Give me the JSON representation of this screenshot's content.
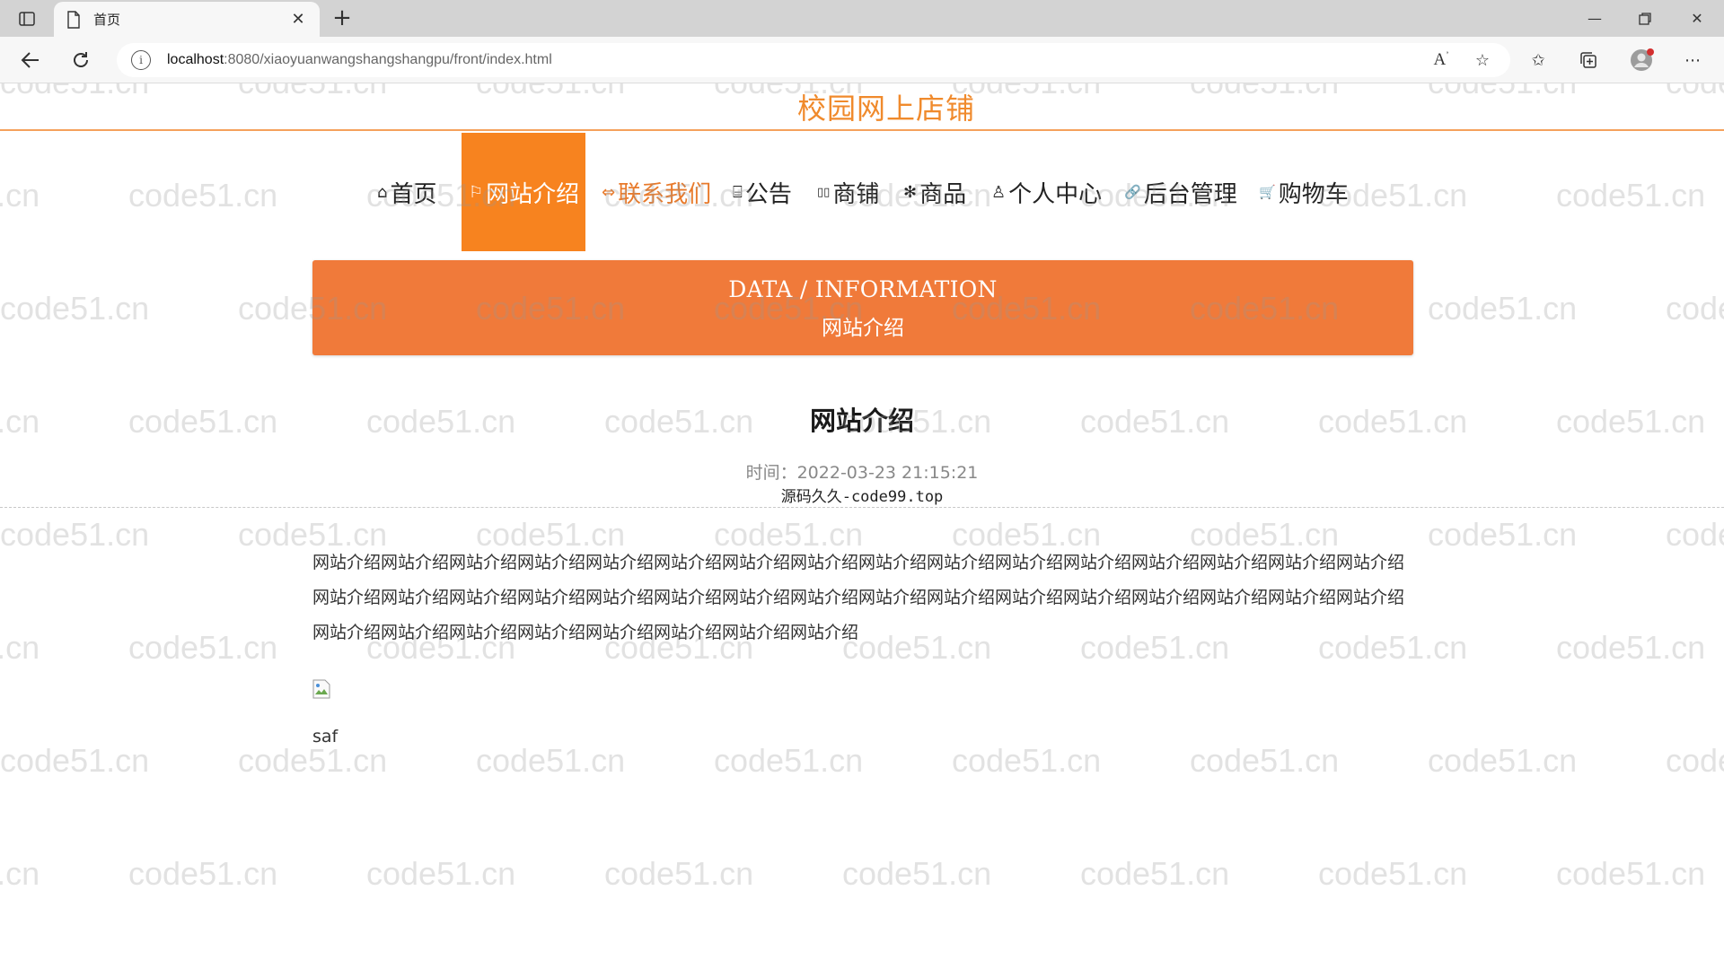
{
  "browser": {
    "tab_title": "首页",
    "url_host": "localhost",
    "url_path": ":8080/xiaoyuanwangshangshangpu/front/index.html"
  },
  "site": {
    "title": "校园网上店铺"
  },
  "nav": {
    "items": [
      {
        "label": "首页",
        "icon": "home-icon",
        "glyph": "⌂"
      },
      {
        "label": "网站介绍",
        "icon": "flag-icon",
        "glyph": "⚐"
      },
      {
        "label": "联系我们",
        "icon": "contact-icon",
        "glyph": "⇔"
      },
      {
        "label": "公告",
        "icon": "book-icon",
        "glyph": "⌸"
      },
      {
        "label": "商铺",
        "icon": "shop-icon",
        "glyph": "▯▯"
      },
      {
        "label": "商品",
        "icon": "asterisk-icon",
        "glyph": "✻"
      },
      {
        "label": "个人中心",
        "icon": "user-icon",
        "glyph": "♙"
      },
      {
        "label": "后台管理",
        "icon": "link-icon",
        "glyph": "🔗"
      },
      {
        "label": "购物车",
        "icon": "cart-icon",
        "glyph": "🛒"
      }
    ]
  },
  "banner": {
    "english": "DATA / INFORMATION",
    "chinese": "网站介绍"
  },
  "article": {
    "title": "网站介绍",
    "time": "时间：2022-03-23 21:15:21",
    "source": "源码久久-code99.top",
    "body": "网站介绍网站介绍网站介绍网站介绍网站介绍网站介绍网站介绍网站介绍网站介绍网站介绍网站介绍网站介绍网站介绍网站介绍网站介绍网站介绍网站介绍网站介绍网站介绍网站介绍网站介绍网站介绍网站介绍网站介绍网站介绍网站介绍网站介绍网站介绍网站介绍网站介绍网站介绍网站介绍网站介绍网站介绍网站介绍网站介绍网站介绍网站介绍网站介绍网站介绍",
    "caption": "saf"
  },
  "watermark": "code51.cn",
  "colors": {
    "accent": "#f7831f",
    "banner": "#f07a3a",
    "title": "#f08a2c"
  }
}
